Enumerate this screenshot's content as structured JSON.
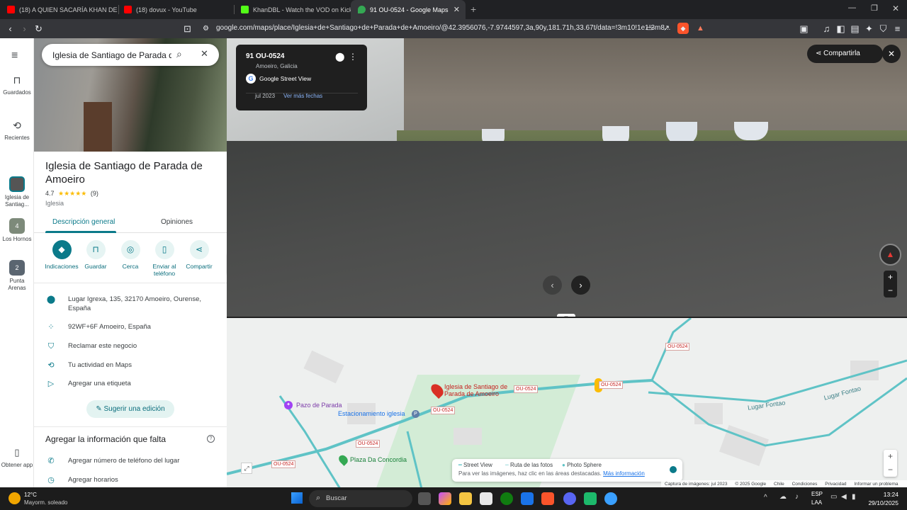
{
  "browser": {
    "tabs": [
      {
        "title": "(18) A QUIEN SACARÍA KHAN DE LA",
        "active": false,
        "icon": "youtube-icon"
      },
      {
        "title": "(18) dovux - YouTube",
        "active": false,
        "icon": "youtube-icon"
      },
      {
        "title": "KhanDBL - Watch the VOD on Kick",
        "active": false,
        "icon": "kick-icon"
      },
      {
        "title": "91 OU-0524 - Google Maps",
        "active": true,
        "icon": "maps-icon"
      }
    ],
    "url": "google.com/maps/place/Iglesia+de+Santiago+de+Parada+de+Amoeiro/@42.3956076,-7.9744597,3a,90y,181.71h,33.67t/data=!3m10!1e1!3m8..."
  },
  "rail": {
    "items": [
      {
        "label": "Guardados",
        "icon": "bookmark-icon"
      },
      {
        "label": "Recientes",
        "icon": "history-icon"
      },
      {
        "label": "Iglesia de Santiag...",
        "icon": "church-thumbnail"
      },
      {
        "label": "Los Hornos",
        "icon": "place-thumbnail",
        "badge": "4"
      },
      {
        "label": "Punta Arenas",
        "icon": "place-thumbnail",
        "badge": "2"
      }
    ],
    "get_app": "Obtener app"
  },
  "search": {
    "value": "Iglesia de Santiago de Parada de An"
  },
  "place": {
    "title": "Iglesia de Santiago de Parada de Amoeiro",
    "rating": "4.7",
    "stars": "★★★★★",
    "reviews": "(9)",
    "category": "Iglesia",
    "tabs": [
      "Descripción general",
      "Opiniones"
    ],
    "actions": [
      {
        "label": "Indicaciones",
        "icon": "directions-icon"
      },
      {
        "label": "Guardar",
        "icon": "bookmark-icon"
      },
      {
        "label": "Cerca",
        "icon": "nearby-icon"
      },
      {
        "label": "Enviar al teléfono",
        "icon": "send-to-phone-icon"
      },
      {
        "label": "Compartir",
        "icon": "share-icon"
      }
    ],
    "info": [
      {
        "text": "Lugar Igrexa, 135, 32170 Amoeiro, Ourense, España",
        "icon": "location-pin-icon"
      },
      {
        "text": "92WF+6F Amoeiro, España",
        "icon": "plus-code-icon"
      },
      {
        "text": "Reclamar este negocio",
        "icon": "shield-check-icon"
      },
      {
        "text": "Tu actividad en Maps",
        "icon": "history-icon"
      },
      {
        "text": "Agregar una etiqueta",
        "icon": "label-icon"
      }
    ],
    "suggest_edit": "Sugerir una edición",
    "missing_title": "Agregar la información que falta",
    "missing_items": [
      {
        "text": "Agregar número de teléfono del lugar",
        "icon": "phone-icon"
      },
      {
        "text": "Agregar horarios",
        "icon": "clock-icon"
      }
    ]
  },
  "streetview": {
    "title": "91 OU-0524",
    "subtitle": "Amoeiro, Galicia",
    "source": "Google Street View",
    "date": "jul 2023",
    "more_dates": "Ver más fechas",
    "share": "Compartirla"
  },
  "map": {
    "labels": {
      "church": "Iglesia de Santiago de Parada de Amoeiro",
      "pazo": "Pazo de Parada",
      "parking": "Estacionamiento iglesia",
      "plaza": "Plaza Da Concordia",
      "lugar1": "Lugar Fontao",
      "lugar2": "Lugar Fontao"
    },
    "road": "OU-0524",
    "legend": {
      "street_view": "Street View",
      "photo_route": "Ruta de las fotos",
      "photo_sphere": "Photo Sphere",
      "hint": "Para ver las imágenes, haz clic en las áreas destacadas.",
      "more_info": "Más información"
    },
    "footer": [
      "Captura de imágenes: jul 2023",
      "© 2025 Google",
      "Chile",
      "Condiciones",
      "Privacidad",
      "Informar un problema"
    ]
  },
  "taskbar": {
    "weather_temp": "12°C",
    "weather_desc": "Mayorm. soleado",
    "search": "Buscar",
    "lang1": "ESP",
    "lang2": "LAA",
    "time": "13:24",
    "date": "29/10/2025"
  },
  "colors": {
    "accent": "#0b7a8a",
    "road": "#5fc3c6",
    "pin": "#d93025"
  }
}
